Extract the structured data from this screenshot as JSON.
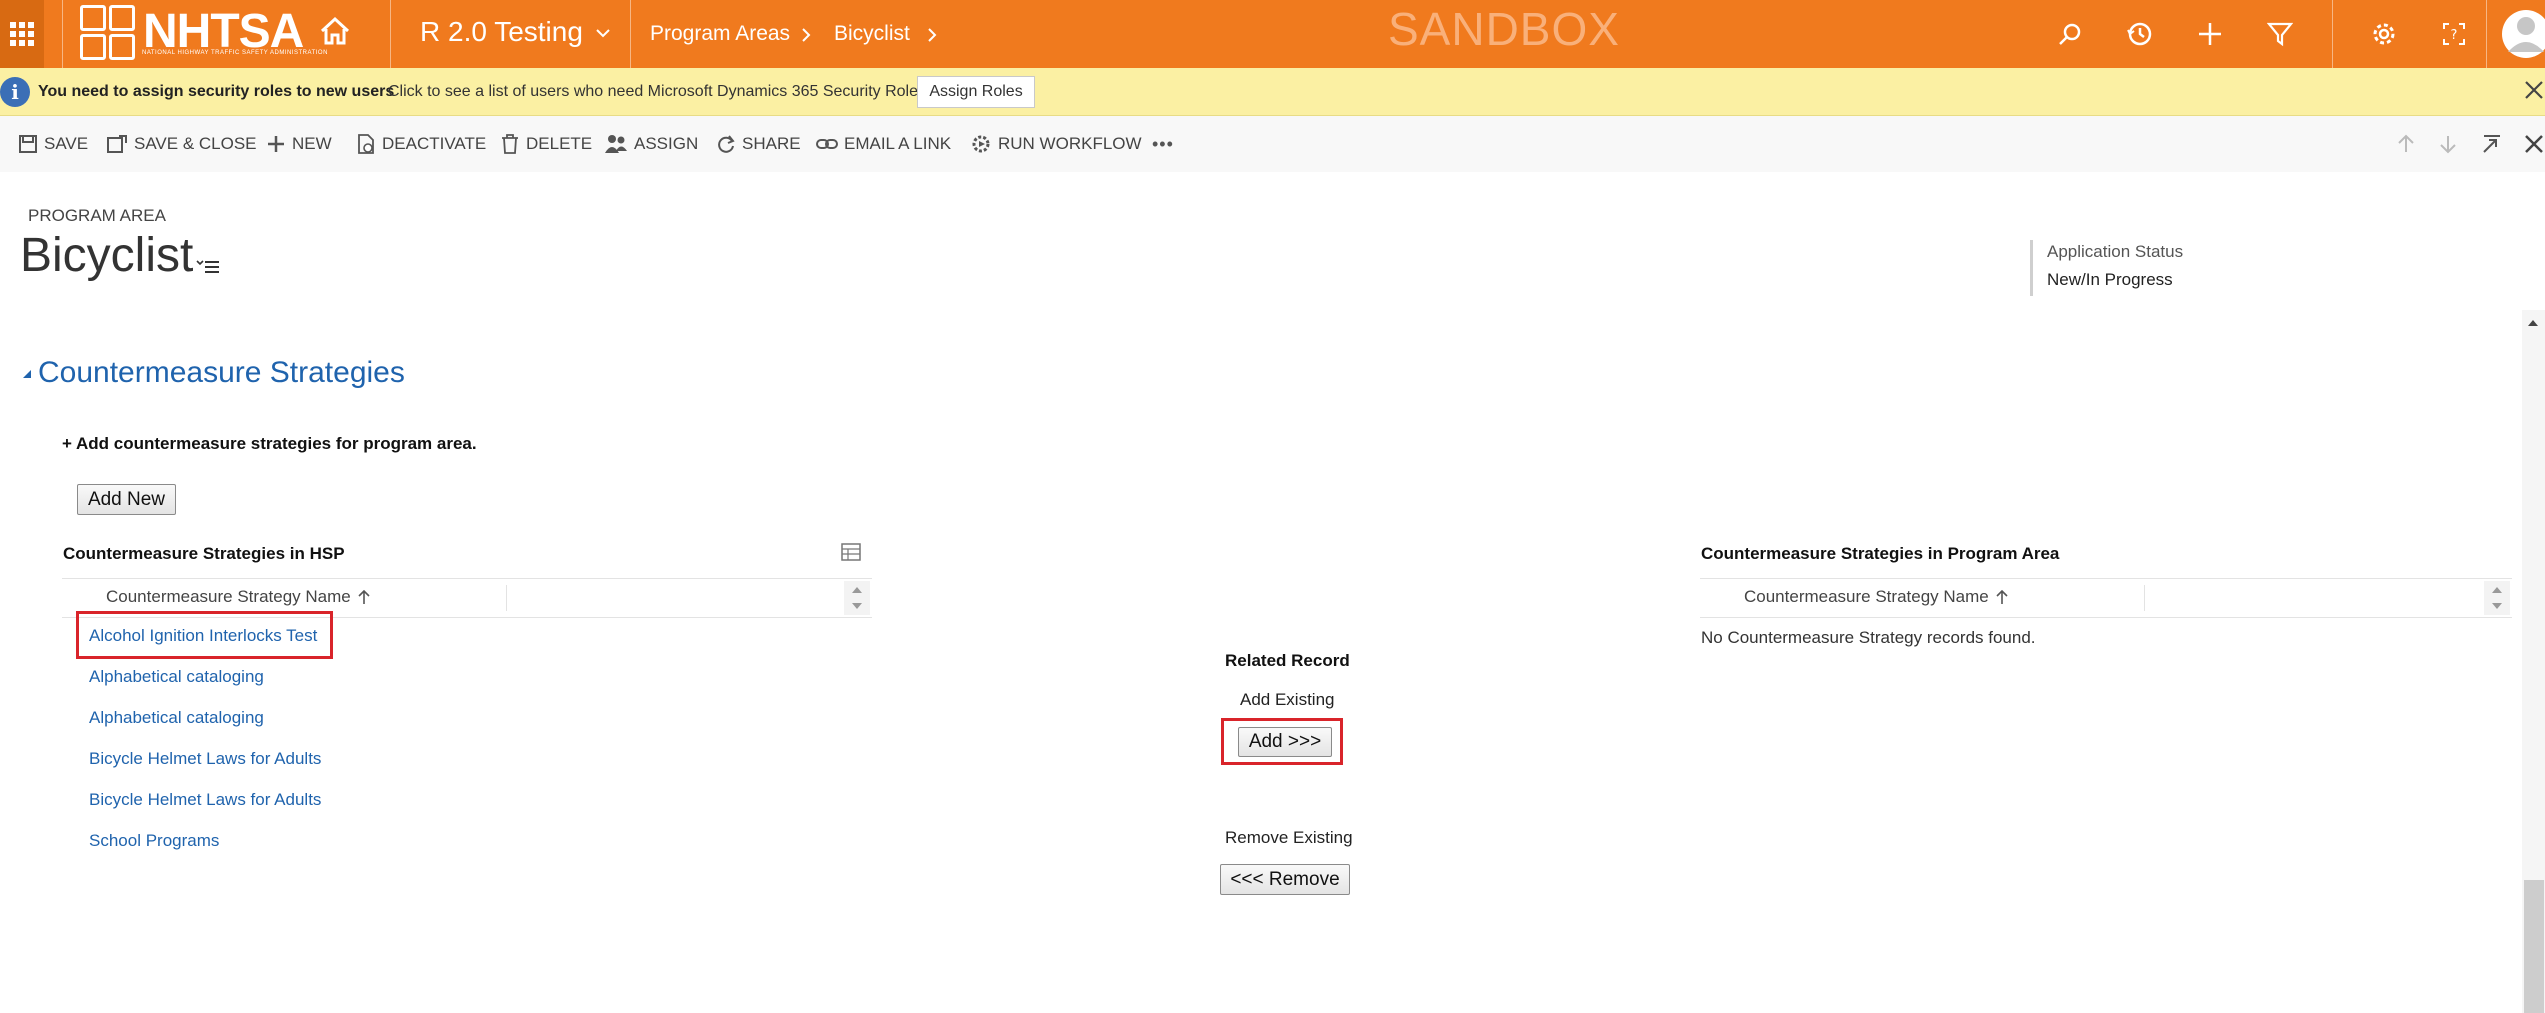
{
  "topbar": {
    "logo_text": "NHTSA",
    "logo_subtitle": "NATIONAL HIGHWAY TRAFFIC SAFETY ADMINISTRATION",
    "app_name": "R 2.0 Testing",
    "breadcrumbs": [
      "Program Areas",
      "Bicyclist"
    ],
    "environment_label": "SANDBOX",
    "icons": [
      "search-icon",
      "recent-icon",
      "create-icon",
      "advanced-find-icon",
      "settings-icon",
      "help-icon",
      "user-avatar"
    ],
    "accent_color": "#f07a1e"
  },
  "notification": {
    "bold_text": "You need to assign security roles to new users",
    "text": "Click to see a list of users who need Microsoft Dynamics 365 Security Roles.",
    "button_label": "Assign Roles"
  },
  "command_bar": {
    "save": "SAVE",
    "save_close": "SAVE & CLOSE",
    "new": "NEW",
    "deactivate": "DEACTIVATE",
    "delete": "DELETE",
    "assign": "ASSIGN",
    "share": "SHARE",
    "email_link": "EMAIL A LINK",
    "run_workflow": "RUN WORKFLOW",
    "more": "•••"
  },
  "record": {
    "entity_type": "PROGRAM AREA",
    "title": "Bicyclist",
    "header_field_label": "Application Status",
    "header_field_value": "New/In Progress"
  },
  "section": {
    "title": "Countermeasure Strategies",
    "instruction": "+ Add countermeasure strategies for program area.",
    "add_new_label": "Add New",
    "hsp_grid": {
      "title": "Countermeasure Strategies in HSP",
      "column": "Countermeasure Strategy Name",
      "rows": [
        "Alcohol Ignition Interlocks Test",
        "Alphabetical cataloging",
        "Alphabetical cataloging",
        "Bicycle Helmet Laws for Adults",
        "Bicycle Helmet Laws for Adults",
        "School Programs"
      ]
    },
    "related": {
      "title": "Related Record",
      "add_label": "Add Existing",
      "add_button": "Add >>>",
      "remove_label": "Remove Existing",
      "remove_button": "<<< Remove"
    },
    "program_grid": {
      "title": "Countermeasure Strategies in Program Area",
      "column": "Countermeasure Strategy Name",
      "empty_message": "No Countermeasure Strategy records found."
    },
    "link_color": "#1f63ad",
    "highlight_color": "#d9242a"
  }
}
